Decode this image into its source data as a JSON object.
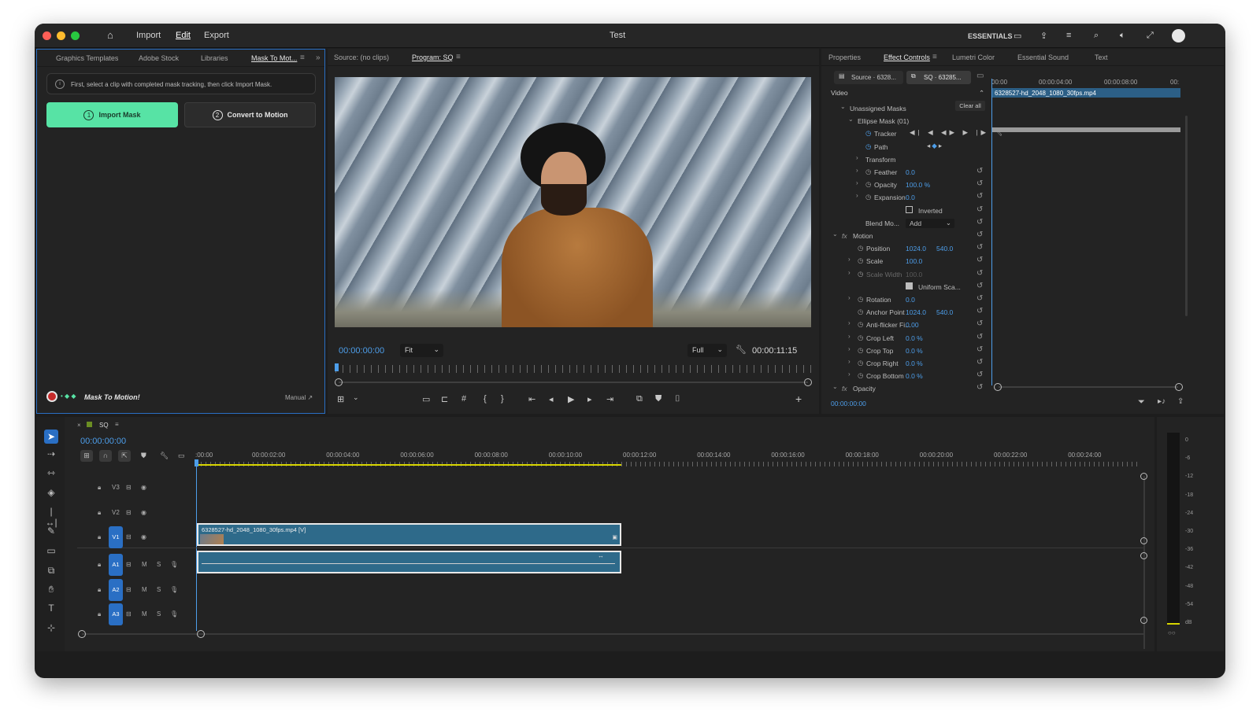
{
  "window": {
    "title": "Test",
    "menu": [
      "Import",
      "Edit",
      "Export"
    ],
    "workspace": "ESSENTIALS"
  },
  "left_panel": {
    "tabs": [
      "Graphics Templates",
      "Adobe Stock",
      "Libraries",
      "Mask To Mot..."
    ],
    "info": "First, select a clip with completed mask tracking, then click Import Mask.",
    "import_btn": {
      "num": "1",
      "label": "Import Mask"
    },
    "convert_btn": {
      "num": "2",
      "label": "Convert to Motion"
    },
    "brand": "Mask To Motion!",
    "manual": "Manual ↗"
  },
  "monitor": {
    "source_tab": "Source: (no clips)",
    "program_tab": "Program: SQ",
    "timecode": "00:00:00:00",
    "fit": "Fit",
    "quality": "Full",
    "duration": "00:00:11:15"
  },
  "effect_panel": {
    "tabs": [
      "Properties",
      "Effect Controls",
      "Lumetri Color",
      "Essential Sound",
      "Text"
    ],
    "source_chip": "Source · 6328...",
    "seq_chip": "SQ · 63285...",
    "section": "Video",
    "ruler": [
      "00:00",
      "00:00:04:00",
      "00:00:08:00",
      "00:"
    ],
    "clip_name": "6328527-hd_2048_1080_30fps.mp4",
    "clear_all": "Clear all",
    "timecode": "00:00:00:00",
    "rows": [
      {
        "chev": "⌄",
        "label": "Unassigned Masks",
        "indent": 1
      },
      {
        "chev": "⌄",
        "label": "Ellipse Mask (01)",
        "indent": 2
      },
      {
        "chev": "",
        "label": "Tracker",
        "indent": 3,
        "stopwatch": true
      },
      {
        "chev": "",
        "label": "Path",
        "indent": 3,
        "stopwatch": true
      },
      {
        "chev": "›",
        "label": "Transform",
        "indent": 3
      },
      {
        "chev": "›",
        "label": "Feather",
        "indent": 3,
        "stopwatch": true,
        "value": "0.0",
        "reset": true
      },
      {
        "chev": "›",
        "label": "Opacity",
        "indent": 3,
        "stopwatch": true,
        "value": "100.0 %",
        "reset": true
      },
      {
        "chev": "›",
        "label": "Expansion",
        "indent": 3,
        "stopwatch": true,
        "value": "0.0",
        "reset": true
      },
      {
        "chev": "",
        "label": "",
        "indent": 3,
        "checkbox": "Inverted",
        "reset": true
      },
      {
        "chev": "",
        "label": "Blend Mo...",
        "indent": 3,
        "select": "Add",
        "reset": true
      },
      {
        "chev": "⌄",
        "label": "Motion",
        "indent": 0,
        "fx": true,
        "reset": true
      },
      {
        "chev": "",
        "label": "Position",
        "indent": 2,
        "stopwatch": true,
        "value": "1024.0",
        "value2": "540.0",
        "reset": true
      },
      {
        "chev": "›",
        "label": "Scale",
        "indent": 2,
        "stopwatch": true,
        "value": "100.0",
        "reset": true
      },
      {
        "chev": "›",
        "label": "Scale Width",
        "indent": 2,
        "stopwatch": true,
        "value": "100.0",
        "dim": true,
        "reset": true
      },
      {
        "chev": "",
        "label": "",
        "indent": 2,
        "checkbox": "Uniform Sca...",
        "reset": true
      },
      {
        "chev": "›",
        "label": "Rotation",
        "indent": 2,
        "stopwatch": true,
        "value": "0.0",
        "reset": true
      },
      {
        "chev": "",
        "label": "Anchor Point",
        "indent": 2,
        "stopwatch": true,
        "value": "1024.0",
        "value2": "540.0",
        "reset": true
      },
      {
        "chev": "›",
        "label": "Anti-flicker Fi...",
        "indent": 2,
        "stopwatch": true,
        "value": "0.00",
        "reset": true
      },
      {
        "chev": "›",
        "label": "Crop Left",
        "indent": 2,
        "stopwatch": true,
        "value": "0.0 %",
        "reset": true
      },
      {
        "chev": "›",
        "label": "Crop Top",
        "indent": 2,
        "stopwatch": true,
        "value": "0.0 %",
        "reset": true
      },
      {
        "chev": "›",
        "label": "Crop Right",
        "indent": 2,
        "stopwatch": true,
        "value": "0.0 %",
        "reset": true
      },
      {
        "chev": "›",
        "label": "Crop Bottom",
        "indent": 2,
        "stopwatch": true,
        "value": "0.0 %",
        "reset": true
      },
      {
        "chev": "⌄",
        "label": "Opacity",
        "indent": 0,
        "fx": true,
        "reset": true
      }
    ]
  },
  "timeline": {
    "sequence": "SQ",
    "timecode": "00:00:00:00",
    "ruler": [
      ":00:00",
      "00:00:02:00",
      "00:00:04:00",
      "00:00:06:00",
      "00:00:08:00",
      "00:00:10:00",
      "00:00:12:00",
      "00:00:14:00",
      "00:00:16:00",
      "00:00:18:00",
      "00:00:20:00",
      "00:00:22:00",
      "00:00:24:00"
    ],
    "video_tracks": [
      "V3",
      "V2",
      "V1"
    ],
    "audio_tracks": [
      "A1",
      "A2",
      "A3"
    ],
    "clip_label": "6328527-hd_2048_1080_30fps.mp4 [V]",
    "audio_mute": "M",
    "audio_solo": "S"
  },
  "meter": {
    "labels": [
      "0",
      "-6",
      "-12",
      "-18",
      "-24",
      "-30",
      "-36",
      "-42",
      "-48",
      "-54",
      "dB"
    ]
  },
  "colors": {
    "accent_green": "#57e3a5",
    "accent_blue": "#2a6fc4",
    "clip_blue": "#2e6a8a",
    "value_blue": "#4d9eea"
  }
}
